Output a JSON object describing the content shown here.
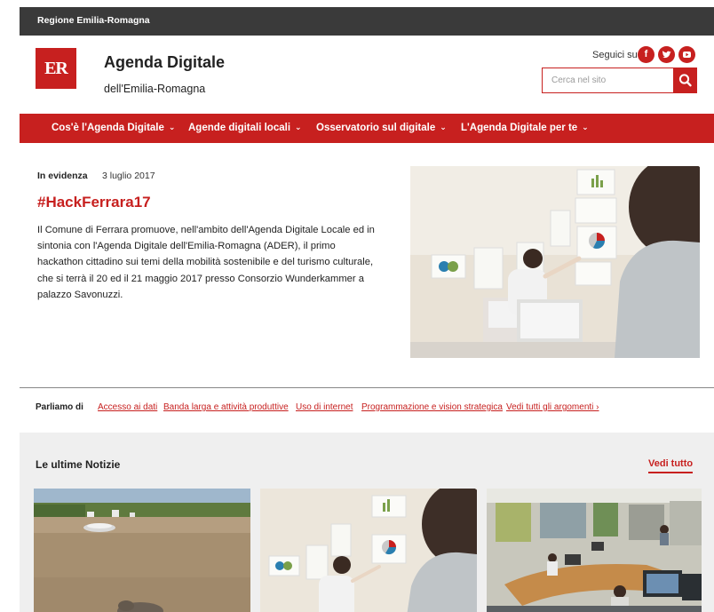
{
  "topbar": {
    "region_label": "Regione Emilia-Romagna"
  },
  "header": {
    "logo_text": "ER",
    "title": "Agenda Digitale",
    "subtitle": "dell'Emilia-Romagna",
    "social_label": "Seguici su",
    "social_icons": [
      "facebook-icon",
      "twitter-icon",
      "youtube-icon"
    ],
    "search_placeholder": "Cerca nel sito"
  },
  "nav": {
    "items": [
      {
        "label": "Cos'è l'Agenda Digitale"
      },
      {
        "label": "Agende digitali locali"
      },
      {
        "label": "Osservatorio sul digitale"
      },
      {
        "label": "L'Agenda Digitale per te"
      }
    ]
  },
  "featured": {
    "label": "In evidenza",
    "date": "3 luglio 2017",
    "title": "#HackFerrara17",
    "text": "Il Comune di Ferrara promuove, nell'ambito dell'Agenda Digitale Locale ed in sintonia con l'Agenda Digitale dell'Emilia-Romagna (ADER), il primo hackathon cittadino sui temi della mobilità sostenibile e del turismo culturale, che si terrà il 20 ed il 21 maggio 2017 presso Consorzio Wunderkammer a palazzo Savonuzzi."
  },
  "topics": {
    "label": "Parliamo di",
    "links": [
      "Accesso ai dati",
      "Banda larga e attività produttive",
      "Uso di internet",
      "Programmazione e vision strategica",
      "Vedi tutti gli argomenti ›"
    ]
  },
  "news": {
    "title": "Le ultime Notizie",
    "more_label": "Vedi tutto"
  },
  "colors": {
    "brand_red": "#c7201f",
    "topbar": "#3a3a3a",
    "news_bg": "#efefef"
  }
}
